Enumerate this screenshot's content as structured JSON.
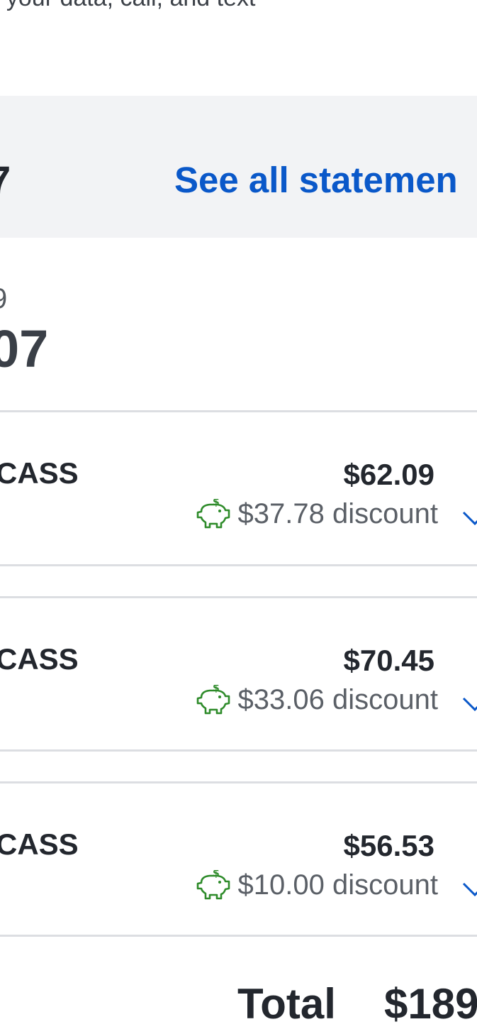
{
  "header": {
    "subtitle_partial": "t your data, call, and text"
  },
  "statements": {
    "left_partial": "7",
    "see_all_label": "See all statemen"
  },
  "balance": {
    "small_partial": "9",
    "amount_partial": "07"
  },
  "lines": [
    {
      "name_partial": "CASS",
      "price": "$62.09",
      "discount": "$37.78 discount"
    },
    {
      "name_partial": "CASS",
      "price": "$70.45",
      "discount": "$33.06 discount"
    },
    {
      "name_partial": "CASS",
      "price": "$56.53",
      "discount": "$10.00 discount"
    }
  ],
  "total": {
    "label": "Total",
    "amount_partial": "$189."
  },
  "colors": {
    "link": "#0a58c9",
    "discount_icon": "#2e8b2a",
    "band": "#f2f3f5"
  },
  "icons": {
    "discount": "piggy-bank-icon",
    "expand": "chevron-down-icon"
  }
}
